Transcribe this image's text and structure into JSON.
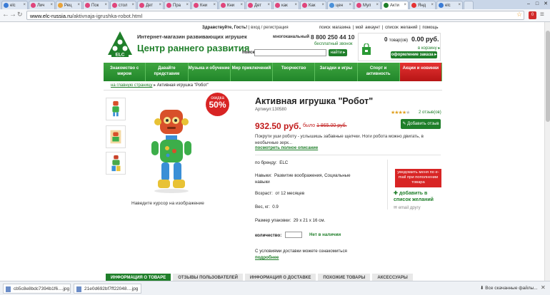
{
  "browser": {
    "tabs": [
      {
        "label": "elc",
        "color": "#3a7bd5"
      },
      {
        "label": "Лич",
        "color": "#e0457b"
      },
      {
        "label": "Рец",
        "color": "#e8a33a"
      },
      {
        "label": "Пок",
        "color": "#e0457b"
      },
      {
        "label": "стол",
        "color": "#e0457b"
      },
      {
        "label": "Дет",
        "color": "#e0457b"
      },
      {
        "label": "Пра",
        "color": "#e0457b"
      },
      {
        "label": "Кни",
        "color": "#e0457b"
      },
      {
        "label": "Кни",
        "color": "#e0457b"
      },
      {
        "label": "Дет",
        "color": "#e0457b"
      },
      {
        "label": "как",
        "color": "#e0457b"
      },
      {
        "label": "Как",
        "color": "#e0457b"
      },
      {
        "label": "цен",
        "color": "#4a90d9"
      },
      {
        "label": "Мул",
        "color": "#e0457b"
      },
      {
        "label": "Акти",
        "color": "#1f7f2a",
        "active": true
      },
      {
        "label": "Янд",
        "color": "#e53232"
      },
      {
        "label": "elc",
        "color": "#3a7bd5"
      }
    ],
    "url_host": "www.elc-russia.ru",
    "url_path": "/aktivnaja-igrushka-robot.html"
  },
  "header": {
    "greeting": "Здравствуйте, Гость!",
    "login": "вход / регистрация",
    "top_links": [
      "поиск магазина",
      "мой аккаунт",
      "список желаний",
      "помощь"
    ],
    "tagline": "Интернет-магазин развивающих игрушек",
    "brand": "Центр раннего развития",
    "logo_text": "ELC",
    "phone_label": "многоканальный",
    "phone": "8 800 250 44 10",
    "free_call": "бесплатный звонок",
    "search_label": "поиск",
    "search_button": "найти",
    "cart_count": "0",
    "cart_items_label": "товар(ов)",
    "cart_total": "0.00 руб.",
    "cart_link": "в корзину",
    "checkout": "оформление заказа"
  },
  "menu": [
    {
      "label": "Знакомство с миром"
    },
    {
      "label": "Давайте представим"
    },
    {
      "label": "Музыка и обучение"
    },
    {
      "label": "Мир приключений"
    },
    {
      "label": "Творчество"
    },
    {
      "label": "Загадки и игры"
    },
    {
      "label": "Спорт и активность"
    },
    {
      "label": "Акции и новинки",
      "highlight": true
    }
  ],
  "breadcrumb": {
    "home": "на главную страницу",
    "current": "Активная игрушка \"Робот\""
  },
  "product": {
    "badge_top": "скидка",
    "badge_pct": "50%",
    "title": "Активная игрушка \"Робот\"",
    "article": "Артикул:130580",
    "rating_stars": 4,
    "reviews": "2 отзыв(ов)",
    "add_review": "Добавить отзыв",
    "price": "932.50 руб.",
    "old_price_label": "было",
    "old_price": "1 865.00 руб.",
    "description": "Покрути уши роботу - услышишь забавные щелчки. Ноги робота можно двигать, в необычные зерк...",
    "full_desc_link": "посмотреть полное описание",
    "zoom_hint": "Наведите курсор на изображение",
    "specs": [
      {
        "label": "по бренду:",
        "value": "ELC"
      },
      {
        "label": "Навыки:",
        "value": "Развитие воображения, Социальные навыки"
      },
      {
        "label": "Возраст:",
        "value": "от 12 месяцев"
      },
      {
        "label": "Вес, кг:",
        "value": "0.9"
      },
      {
        "label": "Размер упаковки:",
        "value": "29 x 21 x 16 см."
      }
    ],
    "qty_label": "количество:",
    "stock": "Нет в наличии",
    "notify": "уведомить меня по e-mail при пополнении товара",
    "wishlist": "добавить в список желаний",
    "email_friend": "email другу",
    "delivery_text": "С условиями доставки можете ознакомиться",
    "delivery_link": "подробнее"
  },
  "info_tabs": [
    {
      "label": "ИНФОРМАЦИЯ О ТОВАРЕ",
      "active": true
    },
    {
      "label": "ОТЗЫВЫ ПОЛЬЗОВАТЕЛЕЙ"
    },
    {
      "label": "ИНФОРМАЦИЯ О ДОСТАВКЕ"
    },
    {
      "label": "ПОХОЖИЕ ТОВАРЫ"
    },
    {
      "label": "АКСЕССУАРЫ"
    }
  ],
  "downloads": {
    "file1": "cb5c8e8bdc7394b1f6....jpg",
    "file2": "21e0d692bf7ff22048....jpg",
    "all": "Все скачанные файлы..."
  }
}
